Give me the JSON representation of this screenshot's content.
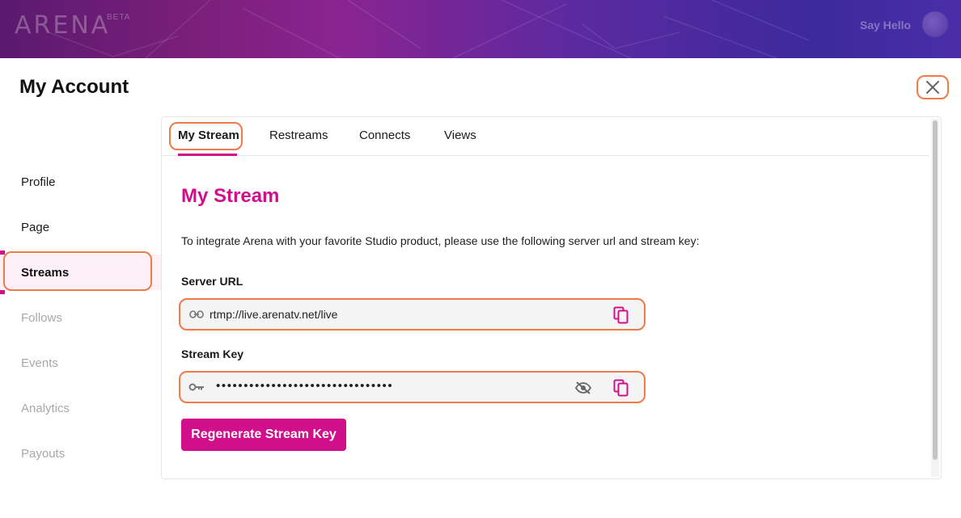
{
  "app": {
    "logo_text": "ARENA",
    "logo_badge": "BETA",
    "greeting": "Say Hello"
  },
  "page": {
    "title": "My Account"
  },
  "sidebar": {
    "items": [
      {
        "label": "Profile",
        "state": "enabled"
      },
      {
        "label": "Page",
        "state": "enabled"
      },
      {
        "label": "Streams",
        "state": "active"
      },
      {
        "label": "Follows",
        "state": "disabled"
      },
      {
        "label": "Events",
        "state": "disabled"
      },
      {
        "label": "Analytics",
        "state": "disabled"
      },
      {
        "label": "Payouts",
        "state": "disabled"
      }
    ]
  },
  "tabs": [
    {
      "label": "My Stream",
      "active": true
    },
    {
      "label": "Restreams",
      "active": false
    },
    {
      "label": "Connects",
      "active": false
    },
    {
      "label": "Views",
      "active": false
    }
  ],
  "stream": {
    "heading": "My Stream",
    "description": "To integrate Arena with your favorite Studio product, please use the following server url and stream key:",
    "server_url_label": "Server URL",
    "server_url_value": "rtmp://live.arenatv.net/live",
    "stream_key_label": "Stream Key",
    "stream_key_masked": "••••••••••••••••••••••••••••••••",
    "regenerate_label": "Regenerate Stream Key"
  },
  "icons": {
    "close": "close-icon",
    "link": "link-icon",
    "key": "key-icon",
    "copy": "copy-icon",
    "visibility_off": "eye-off-icon"
  },
  "colors": {
    "accent": "#d10f8a",
    "highlight": "#f07a4a"
  }
}
